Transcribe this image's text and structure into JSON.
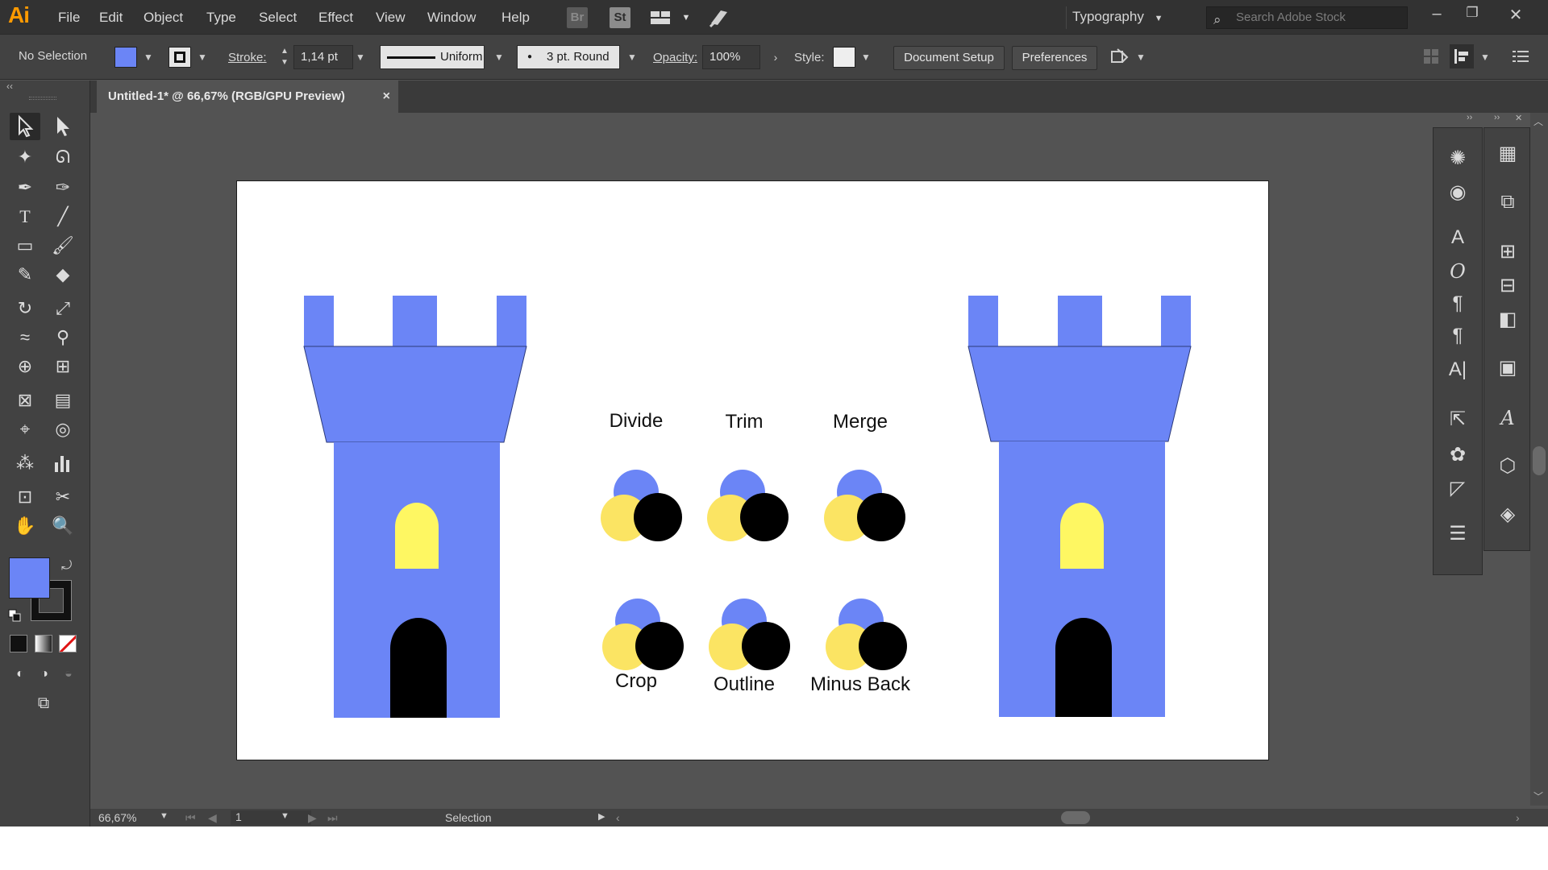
{
  "app": {
    "logo": "Ai",
    "menu": [
      "File",
      "Edit",
      "Object",
      "Type",
      "Select",
      "Effect",
      "View",
      "Window",
      "Help"
    ],
    "bridge_label": "Br",
    "stock_label": "St",
    "workspace": "Typography",
    "search_placeholder": "Search Adobe Stock"
  },
  "controlbar": {
    "selection": "No Selection",
    "fill_color": "#6b85f6",
    "stroke_label": "Stroke:",
    "stroke_weight": "1,14 pt",
    "stroke_profile": "Uniform",
    "brush": "3 pt. Round",
    "opacity_label": "Opacity:",
    "opacity": "100%",
    "style_label": "Style:",
    "document_setup": "Document Setup",
    "preferences": "Preferences"
  },
  "document": {
    "tab_title": "Untitled-1* @ 66,67% (RGB/GPU Preview)",
    "close": "×"
  },
  "artwork": {
    "tower_color": "#6b85f6",
    "window_color": "#fef762",
    "door_color": "#000000",
    "circle_blue": "#6b85f6",
    "circle_yellow": "#fbe463",
    "circle_black": "#000000",
    "pathfinder_labels": {
      "divide": "Divide",
      "trim": "Trim",
      "merge": "Merge",
      "crop": "Crop",
      "outline": "Outline",
      "minus_back": "Minus Back"
    }
  },
  "statusbar": {
    "zoom": "66,67%",
    "artboard_number": "1",
    "tool_status": "Selection"
  }
}
